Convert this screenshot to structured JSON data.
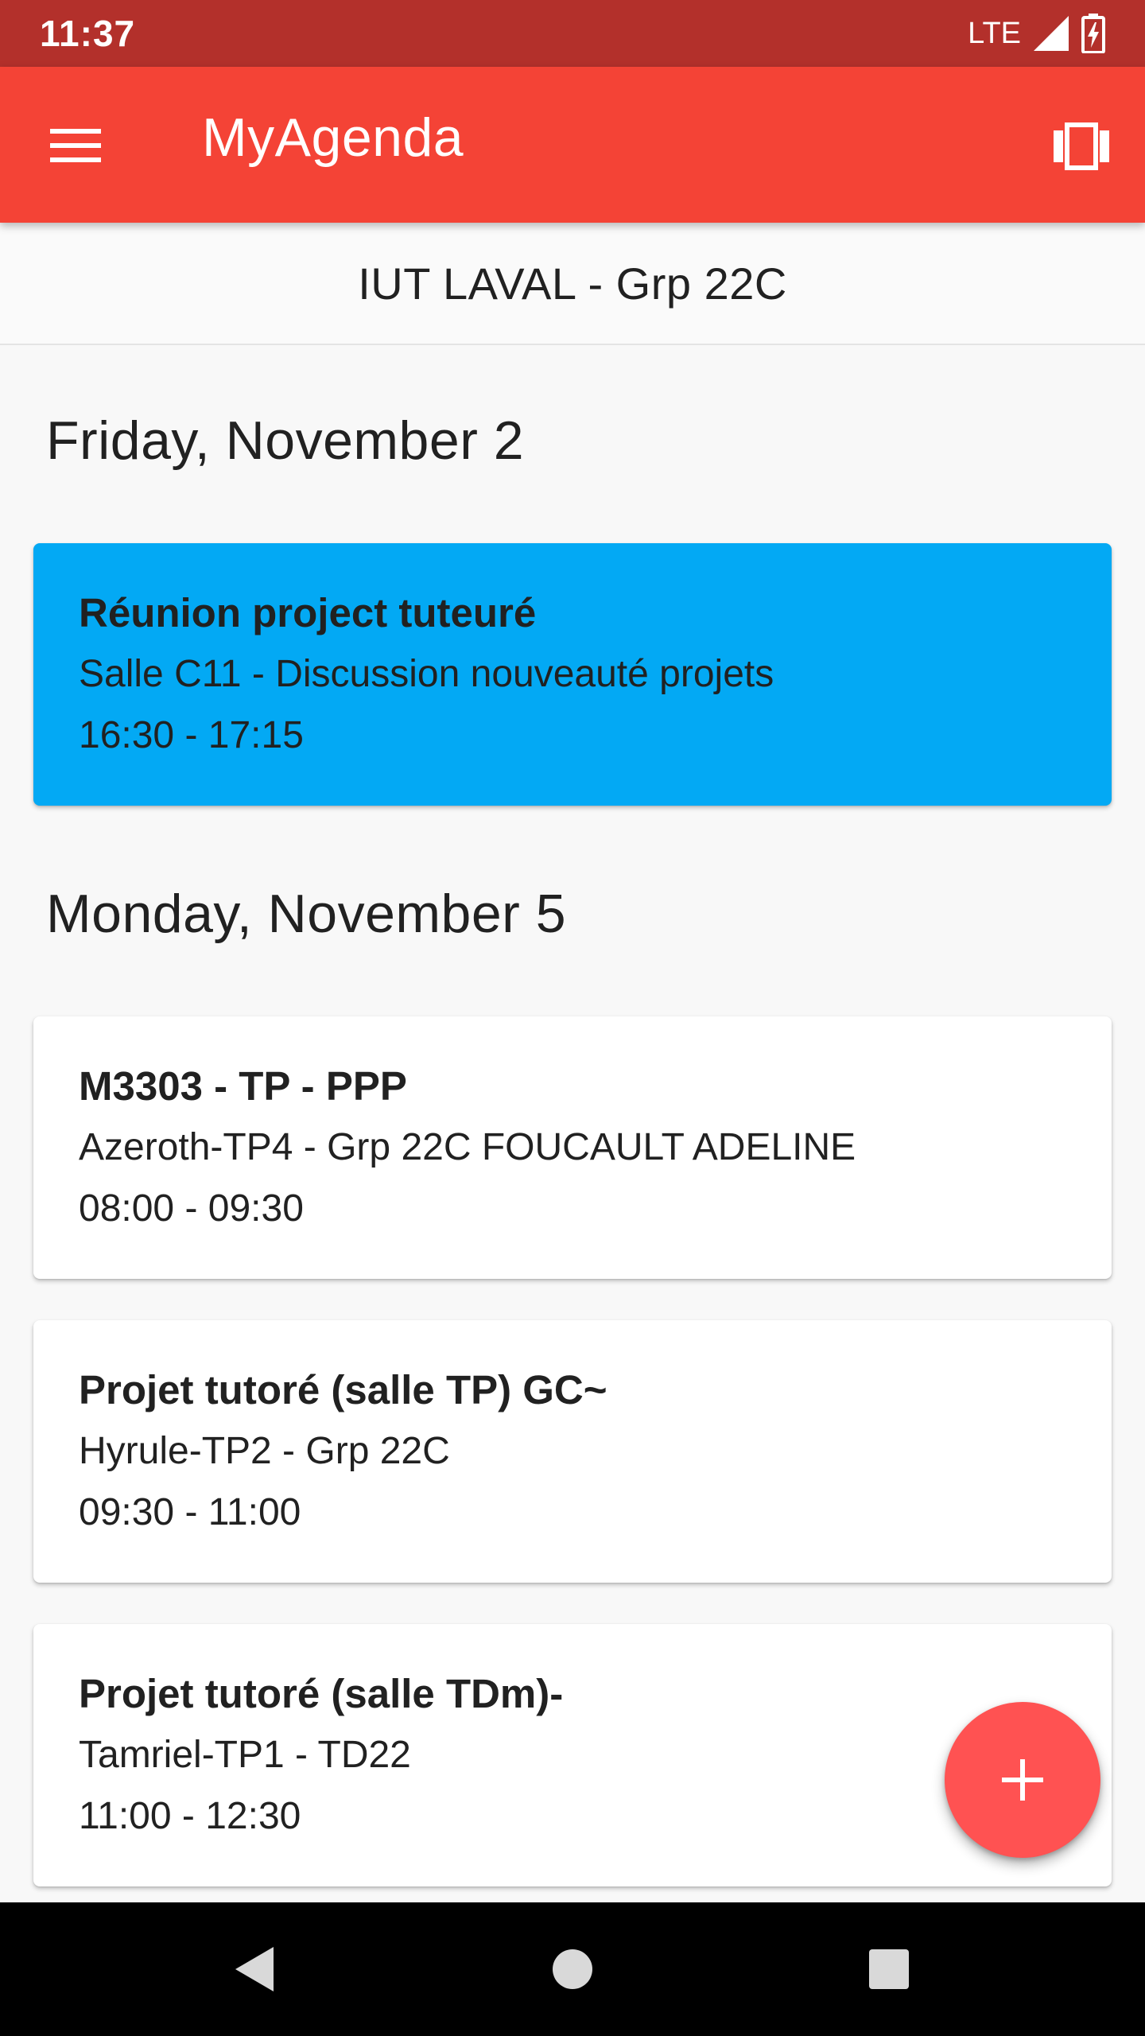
{
  "status_bar": {
    "time": "11:37",
    "network": "LTE",
    "icons": [
      "signal-icon",
      "battery-charging-icon"
    ]
  },
  "app_bar": {
    "title": "MyAgenda",
    "menu_icon": "menu-icon",
    "view_icon": "view-carousel-icon"
  },
  "subtitle": "IUT LAVAL - Grp 22C",
  "days": [
    {
      "label": "Friday, November 2",
      "events": [
        {
          "title": "Réunion project tuteuré",
          "detail": "Salle C11 - Discussion nouveauté projets",
          "time": "16:30 - 17:15",
          "highlight": true
        }
      ]
    },
    {
      "label": "Monday, November 5",
      "events": [
        {
          "title": "M3303 - TP - PPP",
          "detail": "Azeroth-TP4 - Grp 22C FOUCAULT ADELINE",
          "time": "08:00 - 09:30",
          "highlight": false
        },
        {
          "title": "Projet tutoré (salle TP) GC~",
          "detail": "Hyrule-TP2 - Grp 22C",
          "time": "09:30 - 11:00",
          "highlight": false
        },
        {
          "title": "Projet tutoré (salle TDm)-",
          "detail": "Tamriel-TP1 - TD22",
          "time": "11:00 - 12:30",
          "highlight": false
        }
      ]
    }
  ],
  "fab_icon": "plus-icon",
  "colors": {
    "status_bar": "#b3302b",
    "app_bar": "#f44336",
    "highlight_event": "#03a9f4",
    "fab": "#ff5252"
  },
  "nav_icons": [
    "back-icon",
    "home-icon",
    "recents-icon"
  ]
}
